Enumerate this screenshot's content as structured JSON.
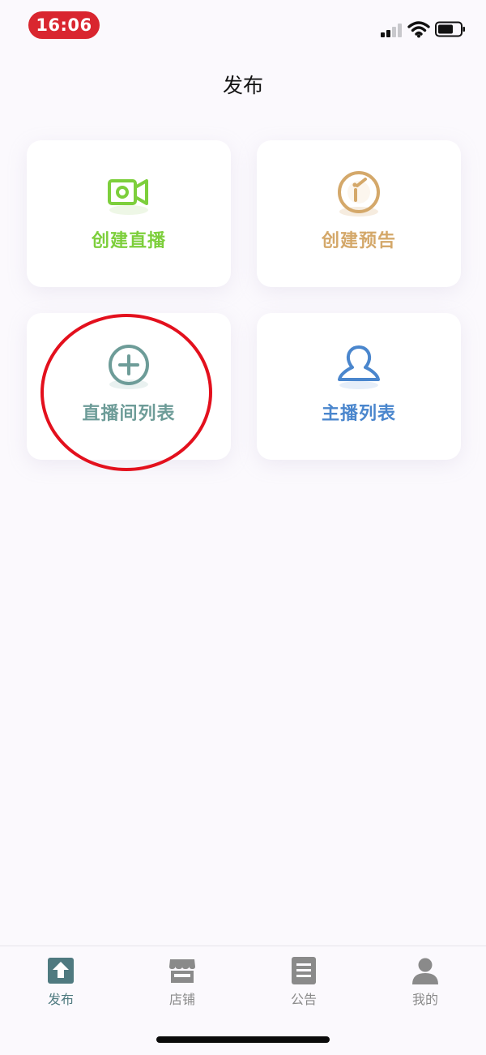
{
  "status_bar": {
    "time": "16:06",
    "icons": [
      "signal-icon",
      "wifi-icon",
      "battery-icon"
    ]
  },
  "header": {
    "title": "发布"
  },
  "cards": [
    {
      "label": "创建直播",
      "icon": "video-camera-icon",
      "color": "#7dcf3c"
    },
    {
      "label": "创建预告",
      "icon": "clock-icon",
      "color": "#d4a86a"
    },
    {
      "label": "直播间列表",
      "icon": "plus-circle-icon",
      "color": "#6d9c98"
    },
    {
      "label": "主播列表",
      "icon": "user-icon",
      "color": "#4a86cd"
    }
  ],
  "tabs": [
    {
      "label": "发布",
      "icon": "upload-icon",
      "active": true,
      "color": "#4f7a80"
    },
    {
      "label": "店铺",
      "icon": "store-icon",
      "active": false,
      "color": "#8a8a8a"
    },
    {
      "label": "公告",
      "icon": "document-icon",
      "active": false,
      "color": "#8a8a8a"
    },
    {
      "label": "我的",
      "icon": "person-icon",
      "active": false,
      "color": "#8a8a8a"
    }
  ],
  "colors": {
    "background": "#fbf9fd",
    "status_time_bg": "#d9262f",
    "highlight": "#e3101d"
  }
}
